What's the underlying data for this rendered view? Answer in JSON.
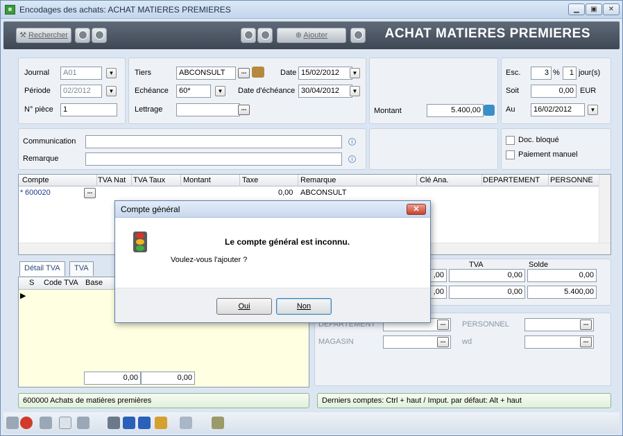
{
  "window": {
    "title": "Encodages des achats:  ACHAT MATIERES PREMIERES"
  },
  "toolbar": {
    "search_label": "Rechercher",
    "add_label": "Ajouter",
    "heading": "ACHAT MATIERES PREMIERES"
  },
  "header": {
    "journal_label": "Journal",
    "journal_value": "A01",
    "periode_label": "Période",
    "periode_value": "02/2012",
    "piece_label": "N° pièce",
    "piece_value": "1",
    "tiers_label": "Tiers",
    "tiers_value": "ABCONSULT",
    "echeance_label": "Echéance",
    "echeance_value": "60*",
    "lettrage_label": "Lettrage",
    "lettrage_value": "",
    "date_label": "Date",
    "date_value": "15/02/2012",
    "date_echeance_label": "Date d'échéance",
    "date_echeance_value": "30/04/2012",
    "montant_label": "Montant",
    "montant_value": "5.400,00",
    "esc_label": "Esc.",
    "esc_value": "3",
    "esc_pct": "%",
    "esc_days": "1",
    "esc_unit": "jour(s)",
    "soit_label": "Soit",
    "soit_value": "0,00",
    "soit_currency": "EUR",
    "au_label": "Au",
    "au_value": "16/02/2012"
  },
  "comm": {
    "communication_label": "Communication",
    "remarque_label": "Remarque",
    "doc_bloque_label": "Doc. bloqué",
    "paiement_manuel_label": "Paiement manuel"
  },
  "grid": {
    "columns": [
      "Compte",
      "TVA Nat",
      "TVA Taux",
      "Montant",
      "Taxe",
      "Remarque",
      "Clé Ana.",
      "DEPARTEMENT",
      "PERSONNE"
    ],
    "row": {
      "marker": "*",
      "compte": "600020",
      "taxe": "0,00",
      "remarque": "ABCONSULT"
    }
  },
  "tva": {
    "tabs": [
      "Détail TVA",
      "TVA"
    ],
    "columns": [
      "S",
      "Code TVA",
      "Base"
    ],
    "total_base": "0,00",
    "total_tva": "0,00"
  },
  "summary": {
    "tva_header": "TVA",
    "solde_header": "Solde",
    "r1_a": ",00",
    "r1_tva": "0,00",
    "r1_solde": "0,00",
    "r2_a": ",00",
    "r2_tva": "0,00",
    "r2_solde": "5.400,00"
  },
  "analytics": {
    "departement_label": "DEPARTEMENT",
    "personnel_label": "PERSONNEL",
    "magasin_label": "MAGASIN",
    "wd_label": "wd"
  },
  "status": {
    "left": "600000  Achats de matières premières",
    "right": "Derniers comptes: Ctrl + haut / Imput. par défaut: Alt + haut"
  },
  "dialog": {
    "title": "Compte général",
    "message": "Le compte général est inconnu.",
    "question": "Voulez-vous l'ajouter ?",
    "yes_label": "Oui",
    "no_label": "Non"
  }
}
